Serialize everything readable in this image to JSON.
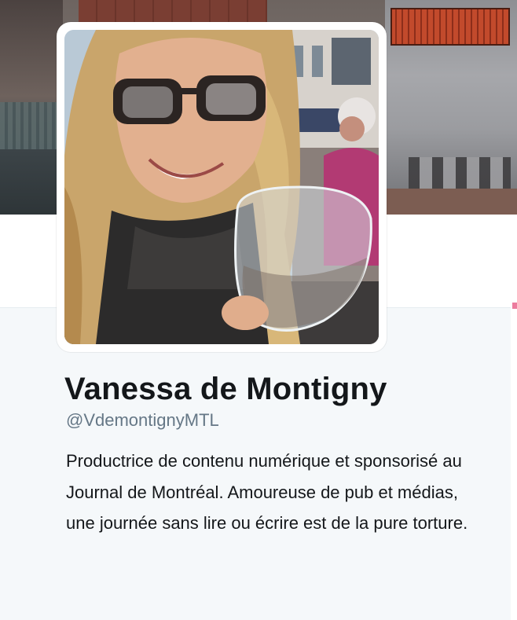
{
  "profile": {
    "name": "Vanessa de Montigny",
    "handle": "@VdemontignyMTL",
    "bio": "Productrice de contenu numérique et sponsorisé au Journal de Montréal. Amoureuse de pub et médias, une journée sans lire ou écrire est de la pure torture."
  },
  "colors": {
    "name_text": "#14171a",
    "handle_text": "#657786",
    "card_background": "#f5f8fa"
  }
}
